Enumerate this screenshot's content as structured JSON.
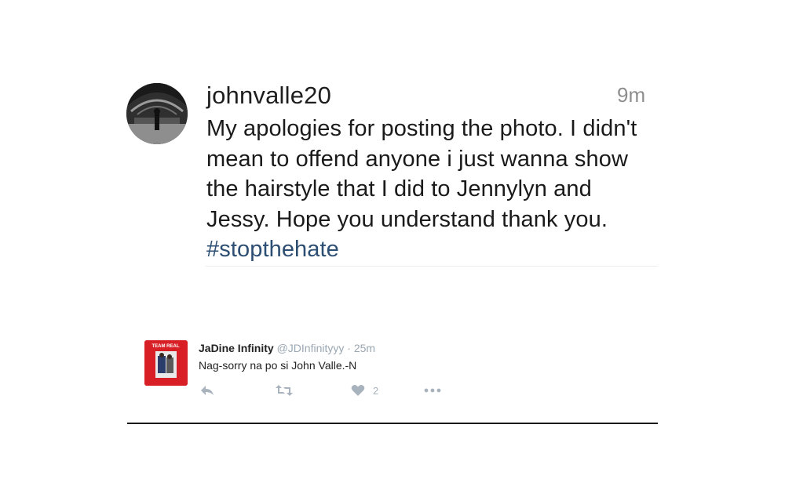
{
  "comment": {
    "username": "johnvalle20",
    "time": "9m",
    "text": "My apologies for posting the photo. I didn't mean to offend anyone i just wanna show the hairstyle that I did to Jennylyn and Jessy. Hope you understand thank you.",
    "hashtag": "#stopthehate",
    "hashtag_color": "#2d4e73"
  },
  "tweet": {
    "logo_text": "TEAM REAL",
    "name": "JaDine Infinity",
    "handle": "@JDInfinityyy",
    "separator": "·",
    "time": "25m",
    "text": "Nag-sorry na po si John Valle.-N",
    "like_count": "2",
    "brand_color": "#d81f26"
  }
}
